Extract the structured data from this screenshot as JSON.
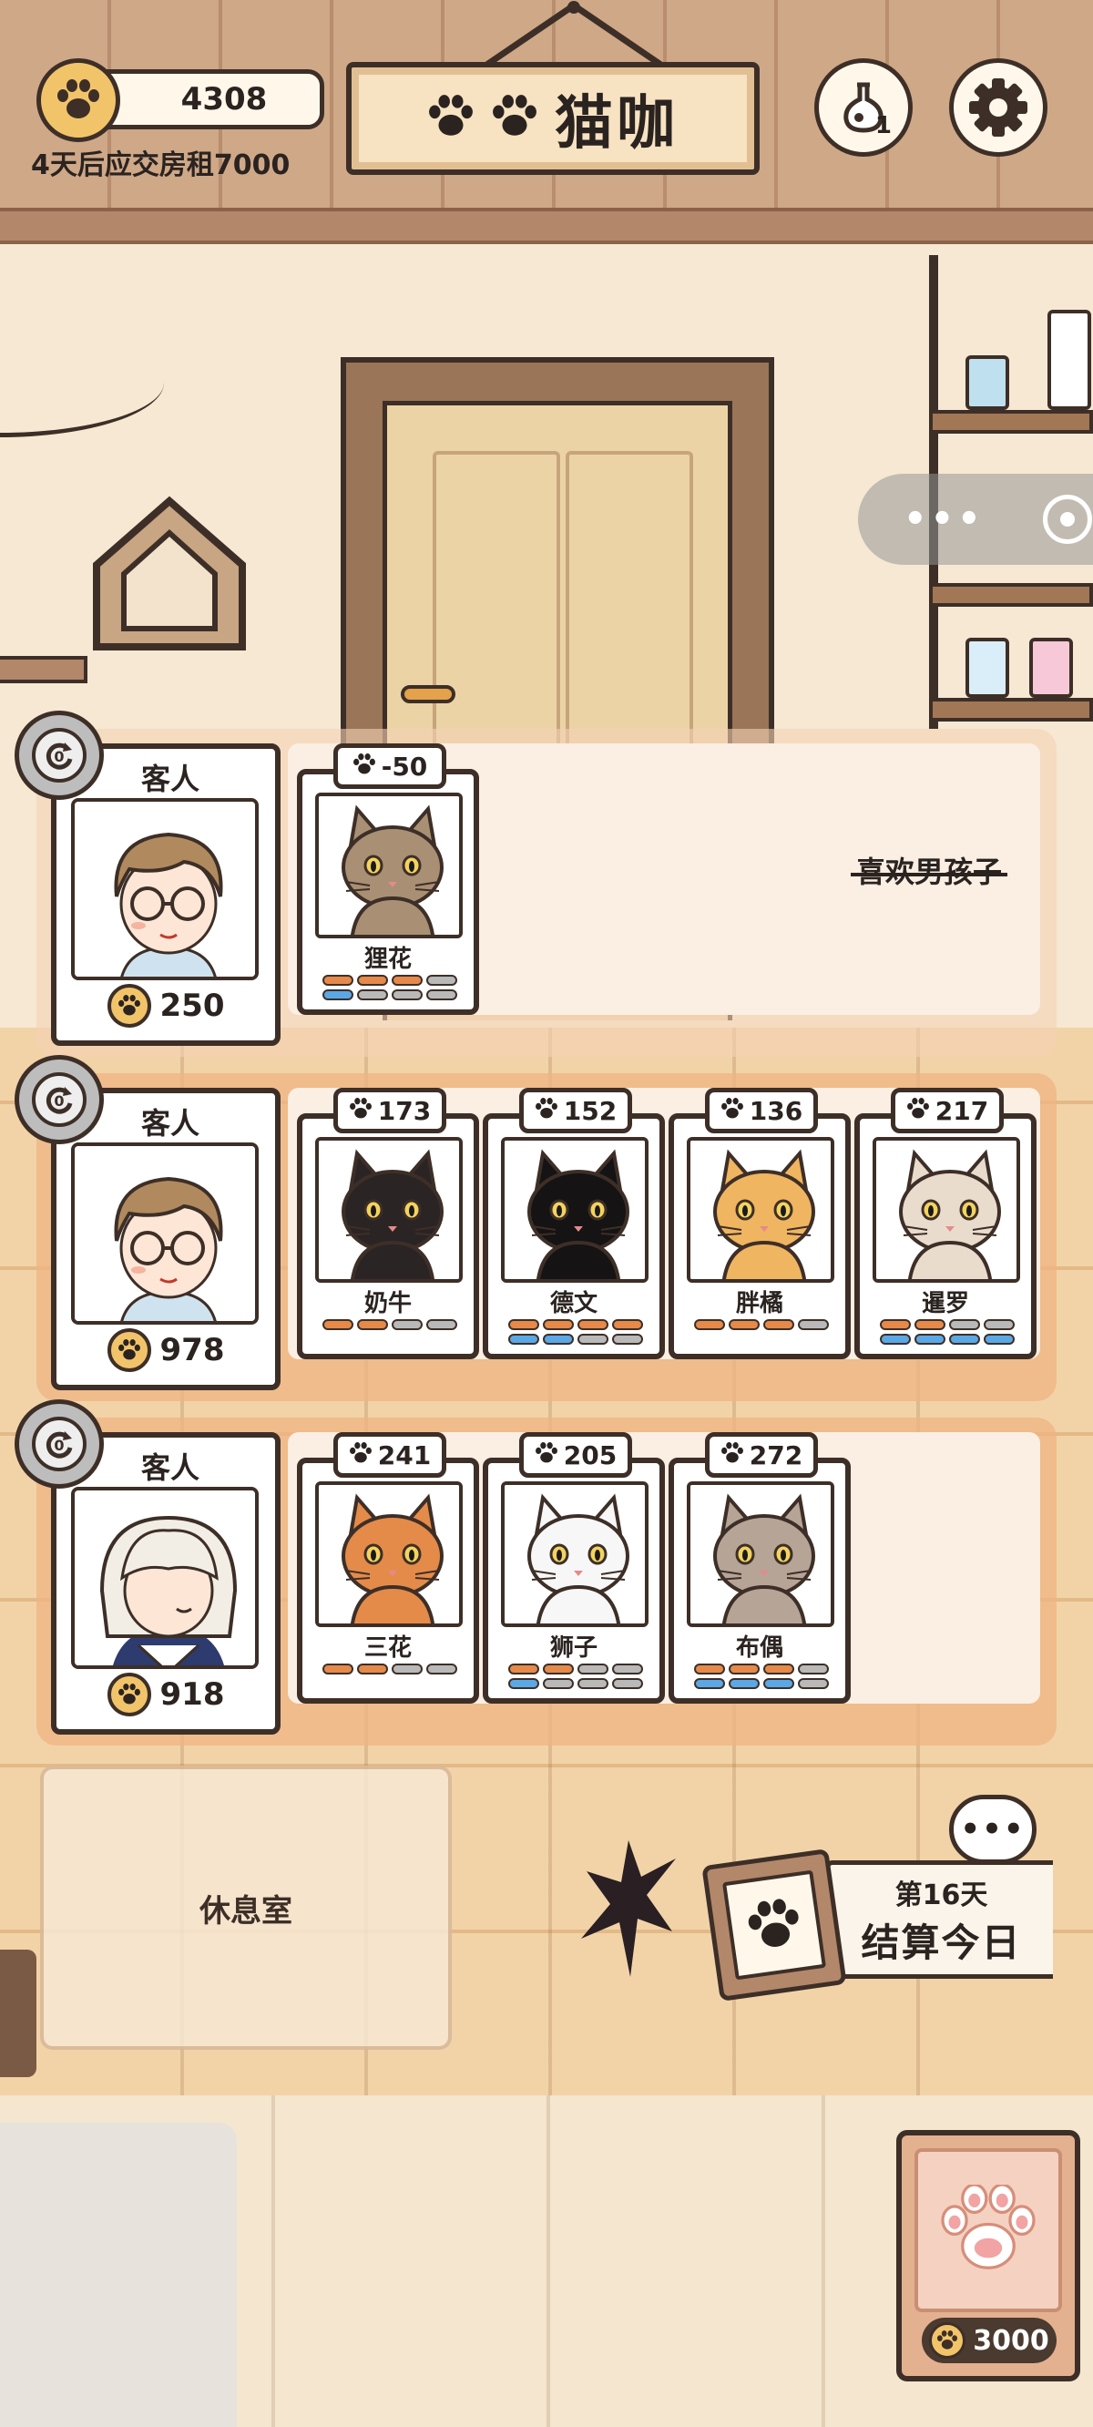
{
  "hud": {
    "coins": "4308",
    "rent_notice": "4天后应交房租7000",
    "title": "猫咖",
    "potion_count": "1"
  },
  "customers": [
    {
      "label": "客人",
      "money": "250",
      "note": "喜欢男孩子",
      "cats": [
        {
          "score": "-50",
          "name": "狸花",
          "bars": [
            [
              "o",
              "o",
              "o",
              "g"
            ],
            [
              "b",
              "g",
              "g",
              "g"
            ]
          ],
          "fur": "#a98f74"
        }
      ]
    },
    {
      "label": "客人",
      "money": "978",
      "cats": [
        {
          "score": "173",
          "name": "奶牛",
          "bars": [
            [
              "o",
              "o",
              "g",
              "g"
            ]
          ],
          "fur": "#2a2424"
        },
        {
          "score": "152",
          "name": "德文",
          "bars": [
            [
              "o",
              "o",
              "o",
              "o"
            ],
            [
              "b",
              "b",
              "g",
              "g"
            ]
          ],
          "fur": "#151313"
        },
        {
          "score": "136",
          "name": "胖橘",
          "bars": [
            [
              "o",
              "o",
              "o",
              "g"
            ]
          ],
          "fur": "#f0b561"
        },
        {
          "score": "217",
          "name": "暹罗",
          "bars": [
            [
              "o",
              "o",
              "g",
              "g"
            ],
            [
              "b",
              "b",
              "b",
              "b"
            ]
          ],
          "fur": "#e9dccd"
        }
      ]
    },
    {
      "label": "客人",
      "money": "918",
      "cats": [
        {
          "score": "241",
          "name": "三花",
          "bars": [
            [
              "o",
              "o",
              "g",
              "g"
            ]
          ],
          "fur": "#e48b4a"
        },
        {
          "score": "205",
          "name": "狮子",
          "bars": [
            [
              "o",
              "o",
              "g",
              "g"
            ],
            [
              "b",
              "g",
              "g",
              "g"
            ]
          ],
          "fur": "#f7f7f7"
        },
        {
          "score": "272",
          "name": "布偶",
          "bars": [
            [
              "o",
              "o",
              "o",
              "g"
            ],
            [
              "b",
              "b",
              "b",
              "g"
            ]
          ],
          "fur": "#b6a497"
        }
      ]
    }
  ],
  "rest_room": "休息室",
  "settle": {
    "day": "第16天",
    "label": "结算今日",
    "chat": "•••"
  },
  "shop": {
    "price": "3000"
  },
  "capsule": {
    "dots": "•••"
  },
  "icons": [
    "paw-icon",
    "potion-icon",
    "gear-icon",
    "refresh-icon",
    "chat-icon",
    "clipboard-icon",
    "target-icon",
    "cat-paw-card-icon"
  ],
  "colors": {
    "orange_pip": "#e58a4a",
    "blue_pip": "#5aa8e6",
    "grey_pip": "#b9b9b9",
    "coin": "#f2c46a",
    "outline": "#3d2f27"
  }
}
